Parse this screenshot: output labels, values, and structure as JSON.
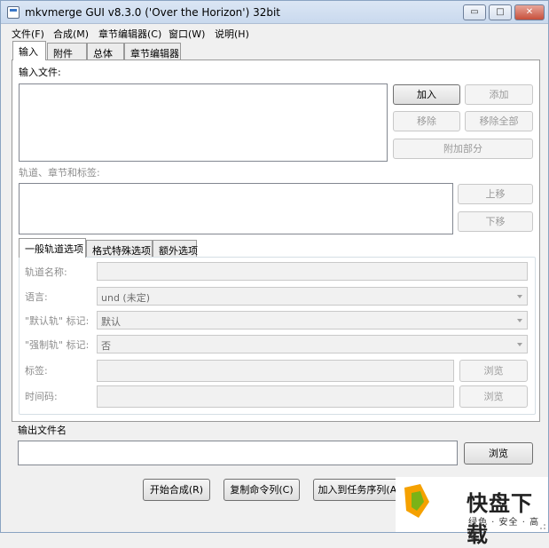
{
  "window": {
    "title": "mkvmerge GUI v8.3.0 ('Over the Horizon') 32bit",
    "controls": {
      "minimize": "▭",
      "maximize": "□",
      "close": "✕"
    }
  },
  "menu": [
    "文件(F)",
    "合成(M)",
    "章节编辑器(C)",
    "窗口(W)",
    "说明(H)"
  ],
  "main_tabs": [
    "输入",
    "附件",
    "总体",
    "章节编辑器"
  ],
  "input": {
    "files_label": "输入文件:",
    "add_button": "加入",
    "append_button": "添加",
    "remove_button": "移除",
    "remove_all_button": "移除全部",
    "additional_parts_button": "附加部分",
    "tracks_label": "轨道、章节和标签:",
    "move_up_button": "上移",
    "move_down_button": "下移"
  },
  "sub_tabs": [
    "一般轨道选项",
    "格式特殊选项",
    "额外选项"
  ],
  "track_options": {
    "track_name_label": "轨道名称:",
    "language_label": "语言:",
    "language_value": "und (未定)",
    "default_flag_label": "\"默认轨\" 标记:",
    "default_flag_value": "默认",
    "forced_flag_label": "\"强制轨\" 标记:",
    "forced_flag_value": "否",
    "tags_label": "标签:",
    "tags_browse": "浏览",
    "timecodes_label": "时间码:",
    "timecodes_browse": "浏览"
  },
  "output": {
    "label": "输出文件名",
    "browse_button": "浏览"
  },
  "actions": {
    "start_muxing": "开始合成(R)",
    "copy_command": "复制命令列(C)",
    "add_to_queue": "加入到任务序列(A)"
  },
  "watermark": {
    "brand": "快盘下载",
    "slogan": "绿色 · 安全 · 高速",
    "accent": "#f5a100",
    "accent2": "#7ab317"
  }
}
